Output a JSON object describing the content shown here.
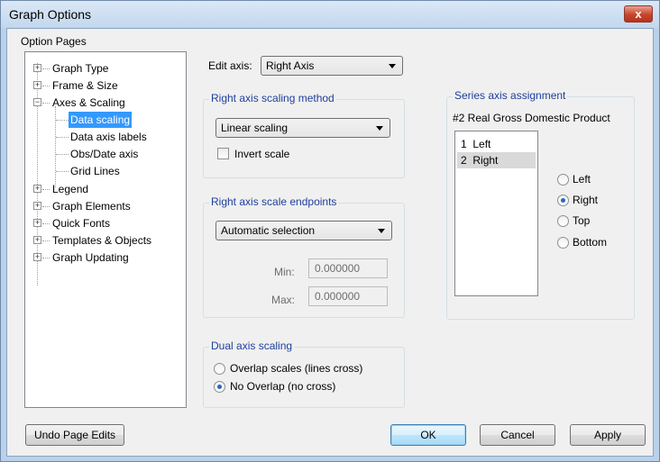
{
  "window": {
    "title": "Graph Options",
    "close_label": "x"
  },
  "tree": {
    "heading": "Option Pages",
    "items": [
      {
        "label": "Graph Type",
        "expander": "+"
      },
      {
        "label": "Frame & Size",
        "expander": "+"
      },
      {
        "label": "Axes & Scaling",
        "expander": "−"
      },
      {
        "label": "Data scaling"
      },
      {
        "label": "Data axis labels"
      },
      {
        "label": "Obs/Date axis"
      },
      {
        "label": "Grid Lines"
      },
      {
        "label": "Legend",
        "expander": "+"
      },
      {
        "label": "Graph Elements",
        "expander": "+"
      },
      {
        "label": "Quick Fonts",
        "expander": "+"
      },
      {
        "label": "Templates & Objects",
        "expander": "+"
      },
      {
        "label": "Graph Updating",
        "expander": "+"
      }
    ],
    "selected": "Data scaling"
  },
  "edit_axis": {
    "label": "Edit axis:",
    "value": "Right Axis"
  },
  "scaling_method": {
    "title": "Right axis scaling method",
    "value": "Linear scaling",
    "invert_label": "Invert scale",
    "invert_checked": false
  },
  "endpoints": {
    "title": "Right axis scale endpoints",
    "value": "Automatic selection",
    "min_label": "Min:",
    "min_value": "0.000000",
    "max_label": "Max:",
    "max_value": "0.000000"
  },
  "dual": {
    "title": "Dual axis scaling",
    "options": [
      "Overlap scales  (lines cross)",
      "No Overlap (no cross)"
    ],
    "selected": "No Overlap (no cross)"
  },
  "series_assignment": {
    "title": "Series axis assignment",
    "series_name": "#2  Real Gross Domestic Product",
    "list": [
      {
        "num": "1",
        "label": "Left"
      },
      {
        "num": "2",
        "label": "Right"
      }
    ],
    "list_selected": "Right",
    "radios": [
      "Left",
      "Right",
      "Top",
      "Bottom"
    ],
    "radio_selected": "Right"
  },
  "buttons": {
    "undo": "Undo Page Edits",
    "ok": "OK",
    "cancel": "Cancel",
    "apply": "Apply"
  }
}
